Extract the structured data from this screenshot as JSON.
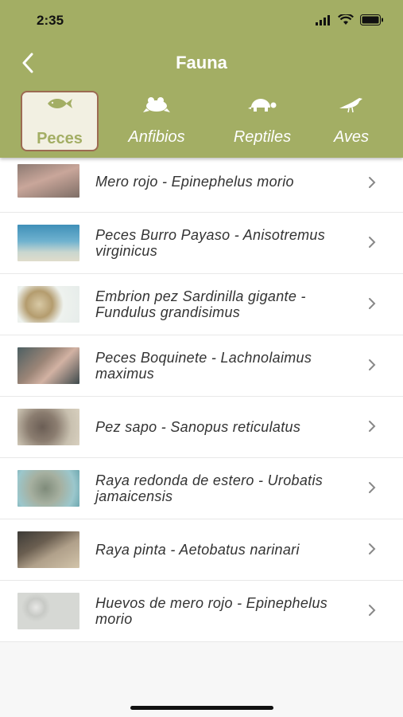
{
  "status": {
    "time": "2:35"
  },
  "header": {
    "title": "Fauna",
    "back_icon": "chevron-left-icon"
  },
  "tabs": [
    {
      "label": "Peces",
      "icon": "fish-icon",
      "active": true
    },
    {
      "label": "Anfibios",
      "icon": "frog-icon",
      "active": false
    },
    {
      "label": "Reptiles",
      "icon": "turtle-icon",
      "active": false
    },
    {
      "label": "Aves",
      "icon": "bird-icon",
      "active": false
    }
  ],
  "items": [
    {
      "name": "Mero rojo - Epinephelus morio"
    },
    {
      "name": "Peces Burro Payaso - Anisotremus virginicus"
    },
    {
      "name": "Embrion pez Sardinilla gigante - Fundulus grandisimus"
    },
    {
      "name": "Peces Boquinete - Lachnolaimus maximus"
    },
    {
      "name": "Pez sapo - Sanopus reticulatus"
    },
    {
      "name": "Raya redonda de estero - Urobatis jamaicensis"
    },
    {
      "name": "Raya pinta - Aetobatus narinari"
    },
    {
      "name": "Huevos de mero rojo - Epinephelus morio"
    }
  ],
  "colors": {
    "header": "#a3ae64",
    "active_tab_border": "#9c6b52"
  }
}
